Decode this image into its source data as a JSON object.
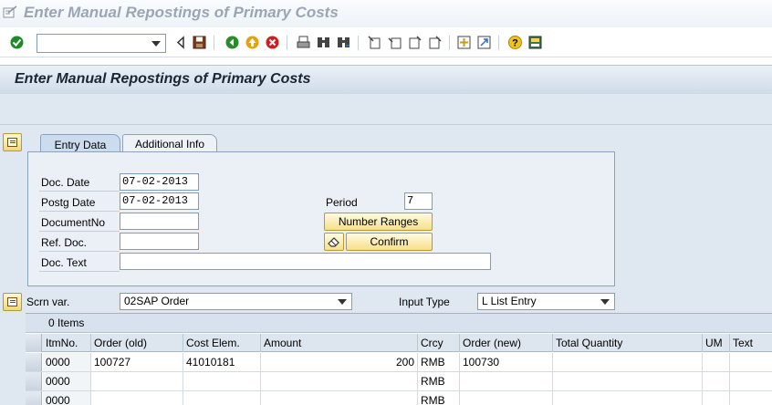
{
  "window": {
    "title": "Enter Manual Repostings of Primary Costs"
  },
  "toolbar": {
    "command_field": {
      "value": ""
    },
    "icons": [
      "checkmark-icon",
      "back-triangle-icon",
      "save-icon",
      "back-icon",
      "exit-icon",
      "cancel-icon",
      "print-icon",
      "find-icon",
      "find-next-icon",
      "first-page-icon",
      "previous-page-icon",
      "next-page-icon",
      "last-page-icon",
      "create-session-icon",
      "shortcut-icon",
      "help-icon",
      "layout-menu-icon"
    ]
  },
  "screen": {
    "title": "Enter Manual Repostings of Primary Costs"
  },
  "tabs": [
    {
      "label": "Entry Data",
      "active": true
    },
    {
      "label": "Additional Info",
      "active": false
    }
  ],
  "form": {
    "doc_date": {
      "label": "Doc. Date",
      "value": "07-02-2013"
    },
    "postg_date": {
      "label": "Postg Date",
      "value": "07-02-2013"
    },
    "document_no": {
      "label": "DocumentNo",
      "value": ""
    },
    "ref_doc": {
      "label": "Ref. Doc.",
      "value": ""
    },
    "doc_text": {
      "label": "Doc. Text",
      "value": ""
    },
    "period": {
      "label": "Period",
      "value": "7"
    },
    "number_ranges_button": "Number Ranges",
    "confirm_button": "Confirm"
  },
  "variant": {
    "scrn_var_label": "Scrn var.",
    "scrn_var_value": "02SAP Order",
    "input_type_label": "Input Type",
    "input_type_value": "L List Entry"
  },
  "table": {
    "caption": "0 Items",
    "columns": [
      "ItmNo.",
      "Order (old)",
      "Cost Elem.",
      "Amount",
      "Crcy",
      "Order (new)",
      "Total Quantity",
      "UM",
      "Text"
    ],
    "rows": [
      [
        "0000",
        "100727",
        "41010181",
        "200",
        "RMB",
        "100730",
        "",
        "",
        ""
      ],
      [
        "0000",
        "",
        "",
        "",
        "RMB",
        "",
        "",
        "",
        ""
      ],
      [
        "0000",
        "",
        "",
        "",
        "RMB",
        "",
        "",
        "",
        ""
      ]
    ]
  },
  "colors": {
    "accent": "#f6e08a",
    "panel": "#eaf0f6",
    "header": "#cfdbe8"
  }
}
